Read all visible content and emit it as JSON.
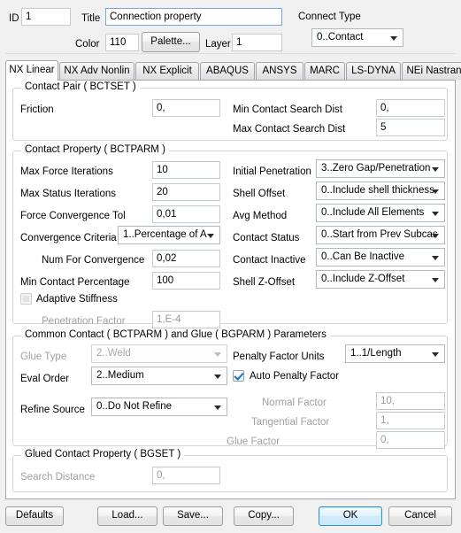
{
  "header": {
    "id_label": "ID",
    "id_value": "1",
    "title_label": "Title",
    "title_value": "Connection property",
    "color_label": "Color",
    "color_value": "110",
    "palette_button": "Palette...",
    "layer_label": "Layer",
    "layer_value": "1",
    "connect_type_label": "Connect Type",
    "connect_type_value": "0..Contact"
  },
  "tabs": [
    {
      "label": "NX Linear",
      "active": true
    },
    {
      "label": "NX Adv Nonlin",
      "active": false
    },
    {
      "label": "NX Explicit",
      "active": false
    },
    {
      "label": "ABAQUS",
      "active": false
    },
    {
      "label": "ANSYS",
      "active": false
    },
    {
      "label": "MARC",
      "active": false
    },
    {
      "label": "LS-DYNA",
      "active": false
    },
    {
      "label": "NEi Nastran",
      "active": false
    }
  ],
  "contact_pair": {
    "group_title": "Contact Pair ( BCTSET )",
    "friction_label": "Friction",
    "friction_value": "0,",
    "min_search_label": "Min Contact Search Dist",
    "min_search_value": "0,",
    "max_search_label": "Max Contact Search Dist",
    "max_search_value": "5"
  },
  "contact_property": {
    "group_title": "Contact Property ( BCTPARM )",
    "max_force_iterations_label": "Max Force Iterations",
    "max_force_iterations_value": "10",
    "max_status_iterations_label": "Max Status Iterations",
    "max_status_iterations_value": "20",
    "force_convergence_tol_label": "Force Convergence Tol",
    "force_convergence_tol_value": "0,01",
    "convergence_criteria_label": "Convergence Criteria",
    "convergence_criteria_value": "1..Percentage of A",
    "num_for_convergence_label": "Num For Convergence",
    "num_for_convergence_value": "0,02",
    "min_contact_percentage_label": "Min Contact Percentage",
    "min_contact_percentage_value": "100",
    "initial_penetration_label": "Initial Penetration",
    "initial_penetration_value": "3..Zero Gap/Penetration",
    "shell_offset_label": "Shell Offset",
    "shell_offset_value": "0..Include shell thickness",
    "avg_method_label": "Avg Method",
    "avg_method_value": "0..Include All Elements",
    "contact_status_label": "Contact Status",
    "contact_status_value": "0..Start from Prev Subcas",
    "contact_inactive_label": "Contact Inactive",
    "contact_inactive_value": "0..Can Be Inactive",
    "shell_z_offset_label": "Shell Z-Offset",
    "shell_z_offset_value": "0..Include Z-Offset",
    "adaptive_stiffness_label": "Adaptive Stiffness",
    "adaptive_stiffness_checked": false,
    "penetration_factor_label": "Penetration Factor",
    "penetration_factor_value": "1,E-4"
  },
  "common_contact": {
    "group_title": "Common Contact ( BCTPARM ) and Glue ( BGPARM ) Parameters",
    "glue_type_label": "Glue Type",
    "glue_type_value": "2..Weld",
    "eval_order_label": "Eval Order",
    "eval_order_value": "2..Medium",
    "refine_source_label": "Refine Source",
    "refine_source_value": "0..Do Not Refine",
    "penalty_factor_units_label": "Penalty Factor Units",
    "penalty_factor_units_value": "1..1/Length",
    "auto_penalty_factor_label": "Auto Penalty Factor",
    "auto_penalty_factor_checked": true,
    "normal_factor_label": "Normal Factor",
    "normal_factor_value": "10,",
    "tangential_factor_label": "Tangential Factor",
    "tangential_factor_value": "1,",
    "glue_factor_label": "Glue Factor",
    "glue_factor_value": "0,"
  },
  "glued_contact": {
    "group_title": "Glued Contact Property ( BGSET )",
    "search_distance_label": "Search Distance",
    "search_distance_value": "0,"
  },
  "footer": {
    "defaults": "Defaults",
    "load": "Load...",
    "save": "Save...",
    "copy": "Copy...",
    "ok": "OK",
    "cancel": "Cancel"
  },
  "colors": {
    "window_bg": "#f0f0f0",
    "panel_bg": "#ffffff",
    "accent": "#2c8fd4",
    "field_border": "#c3cbd3",
    "group_border": "#d6d6d6",
    "disabled_text": "#a0a0a0"
  }
}
